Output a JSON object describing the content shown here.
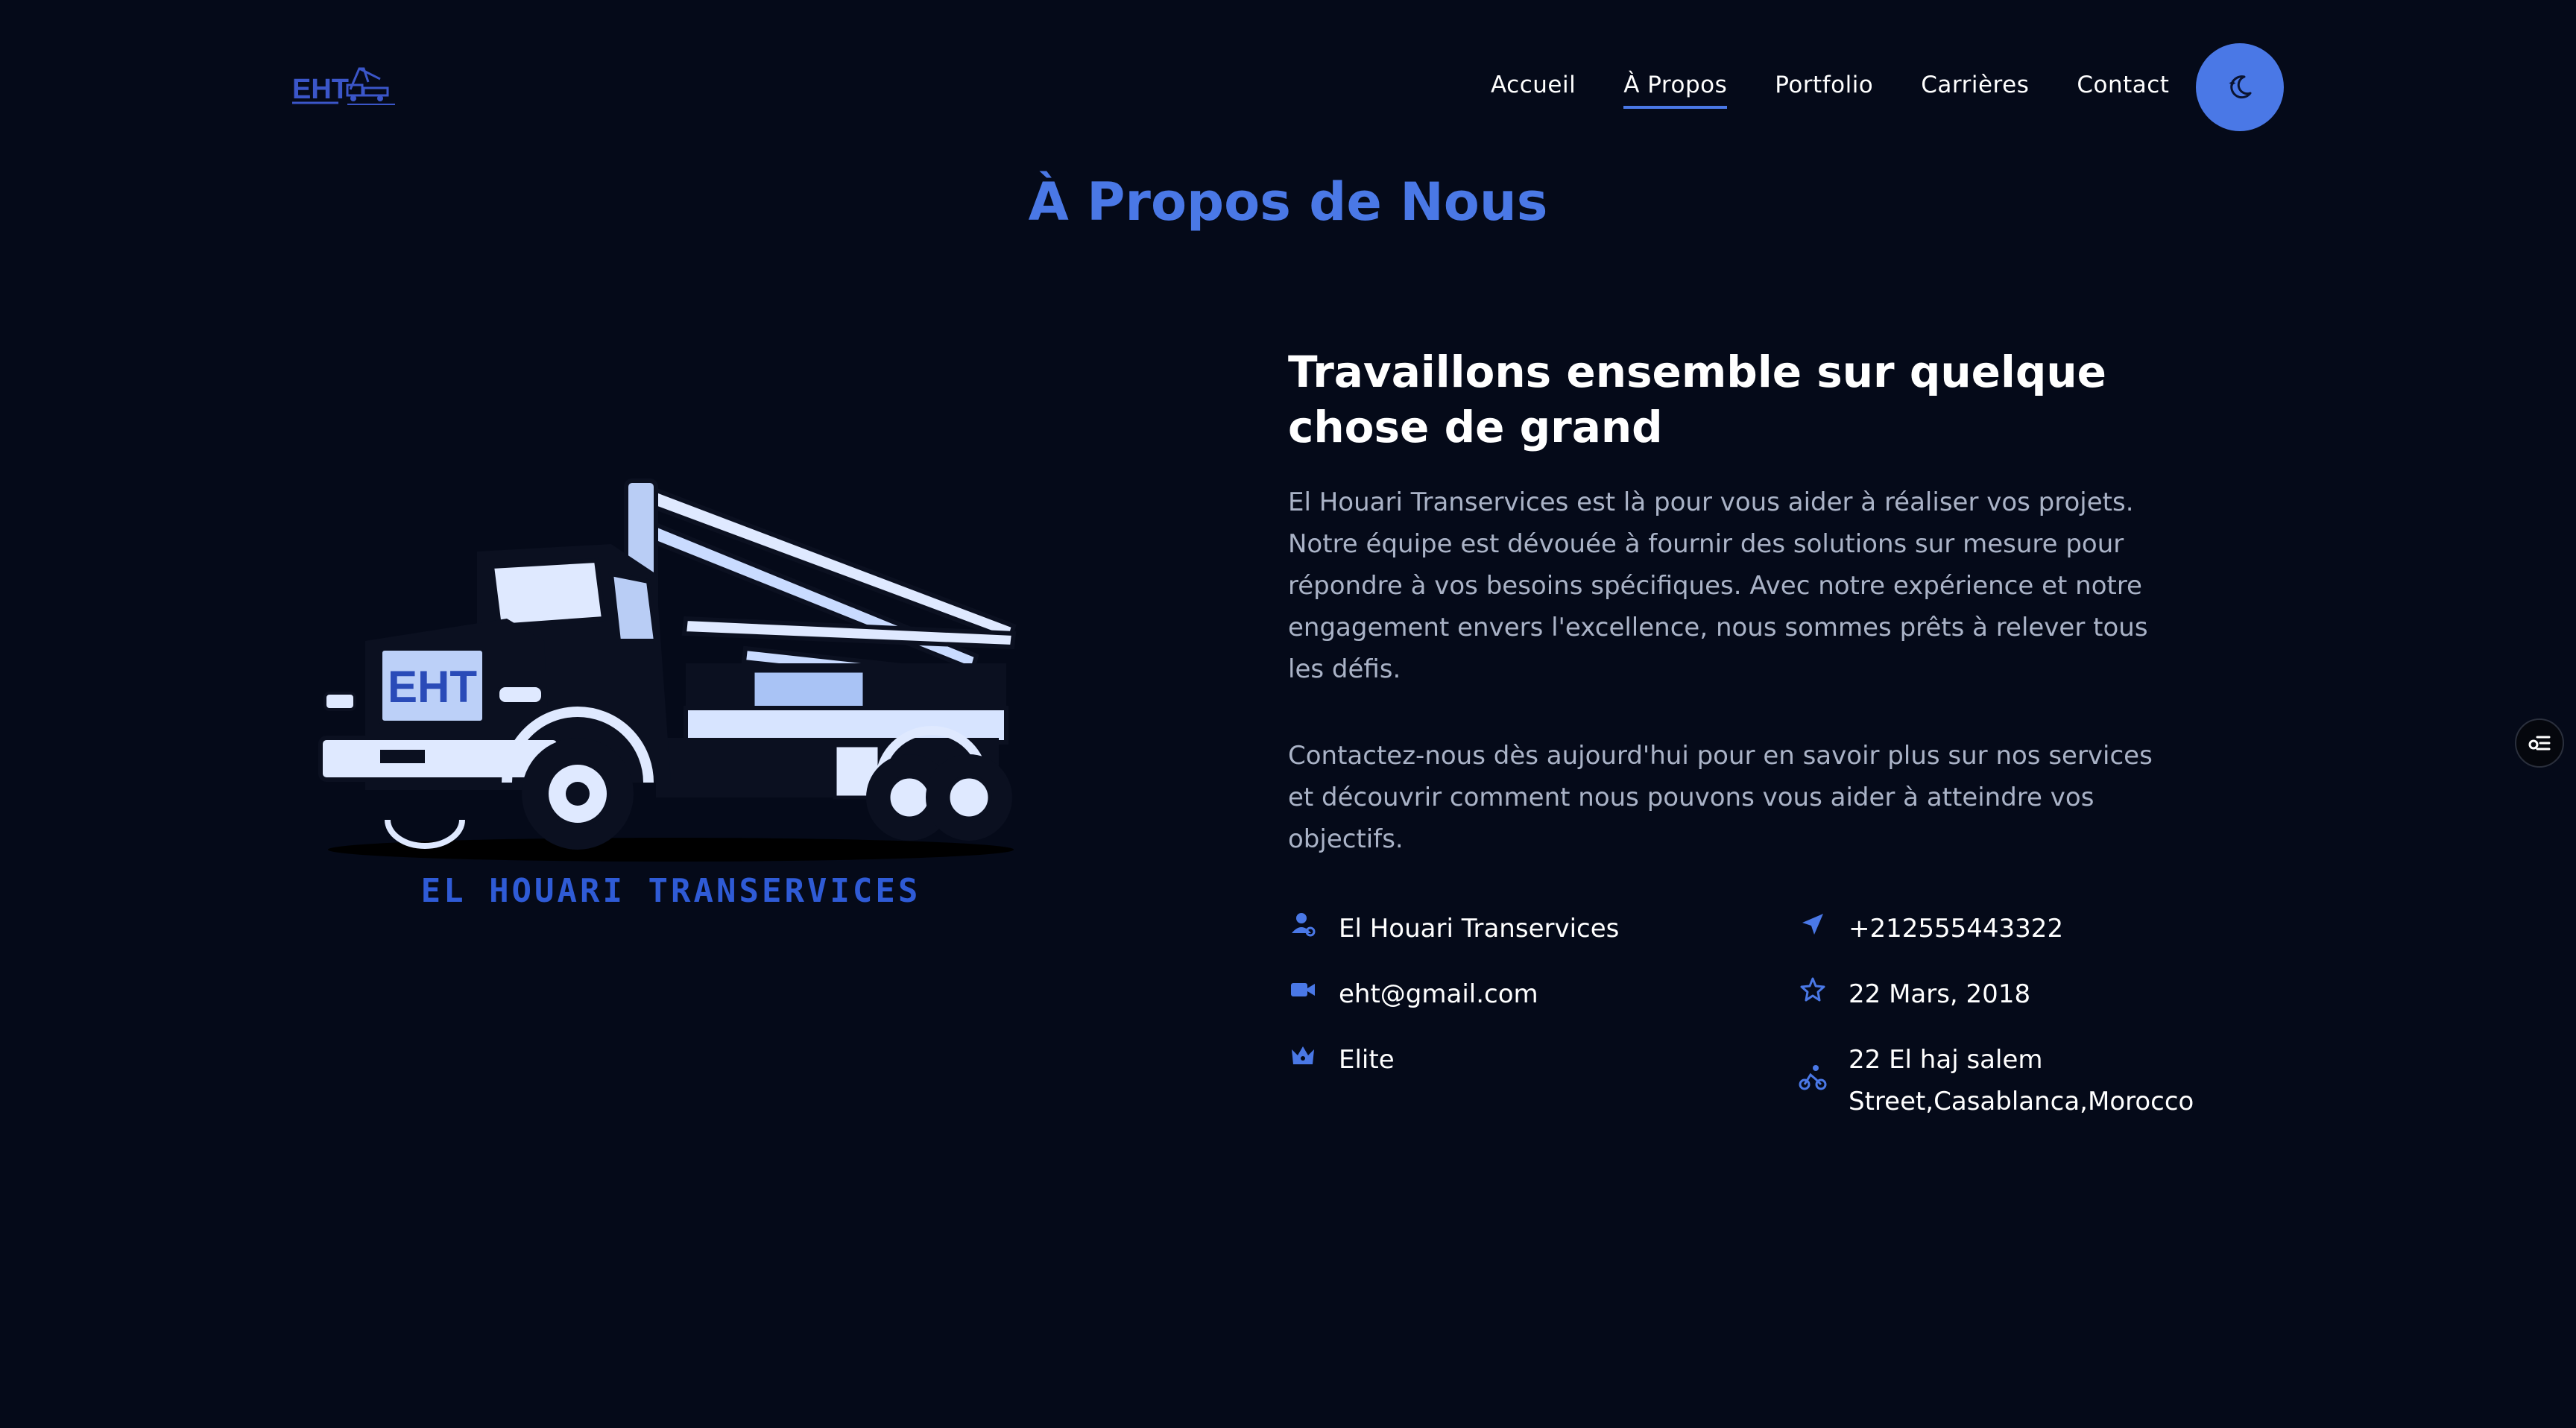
{
  "header": {
    "logo_text": "EHT",
    "nav": [
      {
        "label": "Accueil",
        "active": false
      },
      {
        "label": "À Propos",
        "active": true
      },
      {
        "label": "Portfolio",
        "active": false
      },
      {
        "label": "Carrières",
        "active": false
      },
      {
        "label": "Contact",
        "active": false
      }
    ],
    "theme_toggle_icon": "moon-icon"
  },
  "about": {
    "title": "À Propos de Nous",
    "illustration": {
      "badge_text": "EHT",
      "caption": "EL HOUARI TRANSERVICES"
    },
    "heading": "Travaillons ensemble sur quelque chose de grand",
    "paragraphs": [
      "El Houari Transervices est là pour vous aider à réaliser vos projets. Notre équipe est dévouée à fournir des solutions sur mesure pour répondre à vos besoins spécifiques. Avec notre expérience et notre engagement envers l'excellence, nous sommes prêts à relever tous les défis.",
      "Contactez-nous dès aujourd'hui pour en savoir plus sur nos services et découvrir comment nous pouvons vous aider à atteindre vos objectifs."
    ],
    "info": {
      "name": {
        "icon": "user-icon",
        "text": "El Houari Transervices"
      },
      "phone": {
        "icon": "send-icon",
        "text": "+212555443322"
      },
      "email": {
        "icon": "video-icon",
        "text": "eht@gmail.com"
      },
      "date": {
        "icon": "star-icon",
        "text": "22 Mars, 2018"
      },
      "level": {
        "icon": "crown-icon",
        "text": "Elite"
      },
      "address": {
        "icon": "bike-icon",
        "text": "22 El haj salem Street,Casablanca,Morocco"
      }
    }
  },
  "colors": {
    "background": "#050a19",
    "accent": "#4a78e6",
    "muted_text": "#aab3c7"
  }
}
